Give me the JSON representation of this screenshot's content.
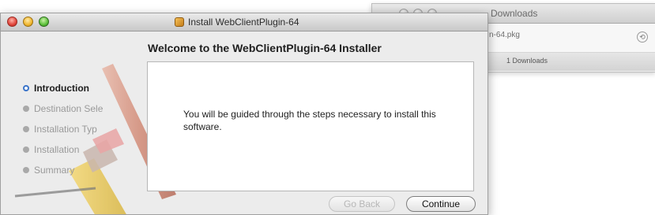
{
  "downloads": {
    "title": "Downloads",
    "file_name": "n-64.pkg",
    "count": "1 Downloads",
    "reveal_icon": "reveal-in-finder-icon"
  },
  "installer": {
    "window_title": "Install WebClientPlugin-64",
    "heading": "Welcome to the WebClientPlugin-64 Installer",
    "steps": [
      {
        "label": "Introduction",
        "active": true
      },
      {
        "label": "Destination Sele",
        "active": false
      },
      {
        "label": "Installation Typ",
        "active": false
      },
      {
        "label": "Installation",
        "active": false
      },
      {
        "label": "Summary",
        "active": false
      }
    ],
    "body_text": "You will be guided through the steps necessary to install this software.",
    "go_back_label": "Go Back",
    "continue_label": "Continue",
    "colors": {
      "active_step_ring": "#3b74c9",
      "close": "#e0443a",
      "minimize": "#f0b62e",
      "zoom": "#5bbf3a"
    }
  }
}
